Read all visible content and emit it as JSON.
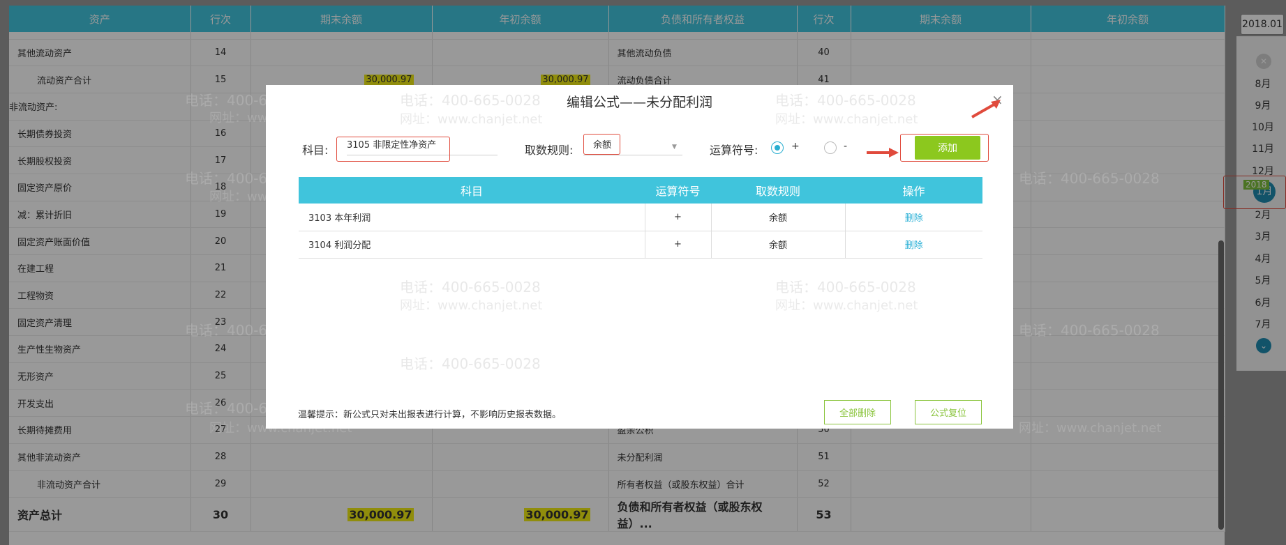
{
  "sheet": {
    "headers": [
      "资产",
      "行次",
      "期末余额",
      "年初余额",
      "负债和所有者权益",
      "行次",
      "期末余额",
      "年初余额"
    ],
    "rows": [
      {
        "left_name": "其他流动资产",
        "left_no": "14",
        "left_end": "",
        "left_begin": "",
        "right_name": "其他流动负债",
        "right_no": "40"
      },
      {
        "left_name": "流动资产合计",
        "left_no": "15",
        "left_end": "30,000.97",
        "left_begin": "30,000.97",
        "right_name": "流动负债合计",
        "right_no": "41"
      },
      {
        "left_name": "非流动资产:",
        "left_no": "",
        "left_end": "",
        "left_begin": "",
        "right_name": "",
        "right_no": ""
      },
      {
        "left_name": "长期债券投资",
        "left_no": "16",
        "left_end": "",
        "left_begin": "",
        "right_name": "",
        "right_no": ""
      },
      {
        "left_name": "长期股权投资",
        "left_no": "17",
        "left_end": "",
        "left_begin": "",
        "right_name": "",
        "right_no": ""
      },
      {
        "left_name": "固定资产原价",
        "left_no": "18",
        "left_end": "",
        "left_begin": "",
        "right_name": "",
        "right_no": ""
      },
      {
        "left_name": "减：累计折旧",
        "left_no": "19",
        "left_end": "",
        "left_begin": "",
        "right_name": "",
        "right_no": ""
      },
      {
        "left_name": "固定资产账面价值",
        "left_no": "20",
        "left_end": "",
        "left_begin": "",
        "right_name": "",
        "right_no": ""
      },
      {
        "left_name": "在建工程",
        "left_no": "21",
        "left_end": "",
        "left_begin": "",
        "right_name": "",
        "right_no": ""
      },
      {
        "left_name": "工程物资",
        "left_no": "22",
        "left_end": "",
        "left_begin": "",
        "right_name": "",
        "right_no": ""
      },
      {
        "left_name": "固定资产清理",
        "left_no": "23",
        "left_end": "",
        "left_begin": "",
        "right_name": "",
        "right_no": ""
      },
      {
        "left_name": "生产性生物资产",
        "left_no": "24",
        "left_end": "",
        "left_begin": "",
        "right_name": "",
        "right_no": ""
      },
      {
        "left_name": "无形资产",
        "left_no": "25",
        "left_end": "",
        "left_begin": "",
        "right_name": "",
        "right_no": ""
      },
      {
        "left_name": "开发支出",
        "left_no": "26",
        "left_end": "",
        "left_begin": "",
        "right_name": "",
        "right_no": ""
      },
      {
        "left_name": "长期待摊费用",
        "left_no": "27",
        "left_end": "",
        "left_begin": "",
        "right_name": "盈余公积",
        "right_no": "50"
      },
      {
        "left_name": "其他非流动资产",
        "left_no": "28",
        "left_end": "",
        "left_begin": "",
        "right_name": "未分配利润",
        "right_no": "51"
      },
      {
        "left_name": "非流动资产合计",
        "left_no": "29",
        "left_end": "",
        "left_begin": "",
        "right_name": "所有者权益（或股东权益）合计",
        "right_no": "52"
      }
    ],
    "total": {
      "left_name": "资产总计",
      "left_no": "30",
      "left_end": "30,000.97",
      "left_begin": "30,000.97",
      "right_name": "负债和所有者权益（或股东权益）...",
      "right_no": "53"
    }
  },
  "sidebar": {
    "year_value": "2018.01",
    "year_tag": "2018",
    "months": [
      "8月",
      "9月",
      "10月",
      "11月",
      "12月",
      "1月",
      "2月",
      "3月",
      "4月",
      "5月",
      "6月",
      "7月"
    ],
    "active_month": "1月"
  },
  "dialog": {
    "title": "编辑公式——未分配利润",
    "close_glyph": "×",
    "subject_label": "科目:",
    "subject_value": "3105 非限定性净资产",
    "rule_label": "取数规则:",
    "rule_value": "余额",
    "operator_label": "运算符号:",
    "op_plus": "+",
    "op_minus": "-",
    "add_button": "添加",
    "table_headers": [
      "科目",
      "运算符号",
      "取数规则",
      "操作"
    ],
    "formula_rows": [
      {
        "subject": "3103 本年利润",
        "operator": "+",
        "rule": "余额",
        "action": "删除"
      },
      {
        "subject": "3104 利润分配",
        "operator": "+",
        "rule": "余额",
        "action": "删除"
      }
    ],
    "tip": "温馨提示：新公式只对未出报表进行计算，不影响历史报表数据。",
    "delete_all_button": "全部删除",
    "reset_button": "公式复位"
  },
  "watermark": {
    "phone": "电话：400-665-0028",
    "site": "网址：www.chanjet.net"
  },
  "colors": {
    "header_cyan": "#41c5de",
    "accent_green": "#8cc81e",
    "link_blue": "#2ab0d6",
    "highlight_yellow": "#f0ec15",
    "annotation_red": "#e04a3c"
  }
}
